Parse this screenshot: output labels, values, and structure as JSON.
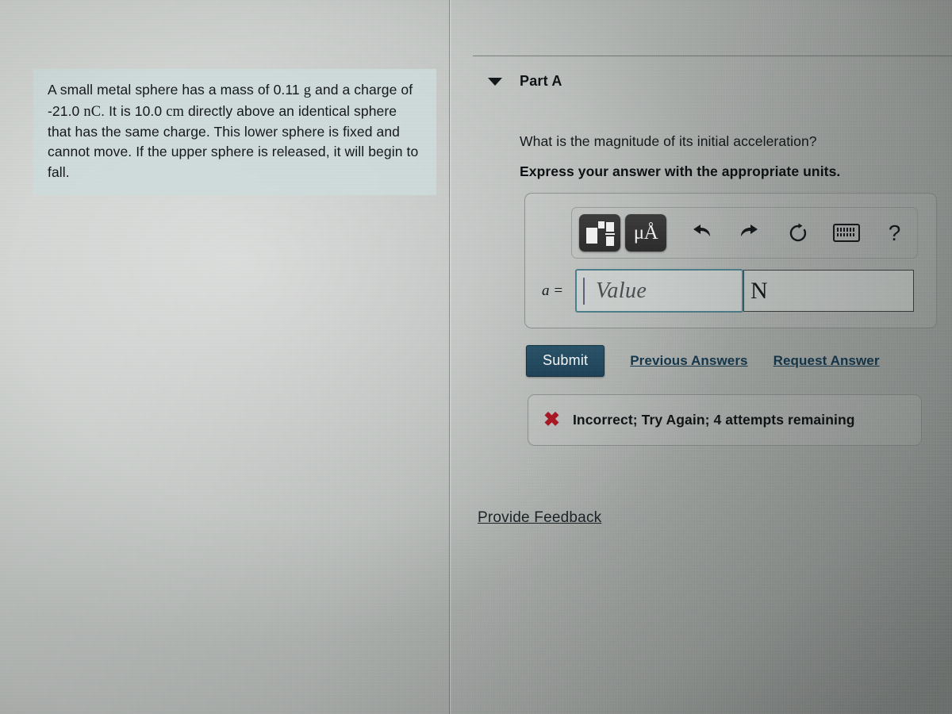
{
  "problem": {
    "text_part1": "A small metal sphere has a mass of 0.11 ",
    "mass_unit": "g",
    "text_part2": " and a charge of -21.0 ",
    "charge_unit": "nC",
    "text_part3": ". It is 10.0 ",
    "distance_unit": "cm",
    "text_part4": " directly above an identical sphere that has the same charge. This lower sphere is fixed and cannot move. If the upper sphere is released, it will begin to fall.",
    "full_text": "A small metal sphere has a mass of 0.11 g and a charge of -21.0 nC. It is 10.0 cm directly above an identical sphere that has the same charge. This lower sphere is fixed and cannot move. If the upper sphere is released, it will begin to fall."
  },
  "part": {
    "label": "Part A",
    "caret_icon": "caret-down-icon",
    "question": "What is the magnitude of its initial acceleration?",
    "instruction": "Express your answer with the appropriate units."
  },
  "toolbar": {
    "buttons": [
      {
        "name": "template-icon",
        "label": ""
      },
      {
        "name": "units-icon",
        "label": "μÅ"
      },
      {
        "name": "undo-icon",
        "label": ""
      },
      {
        "name": "redo-icon",
        "label": ""
      },
      {
        "name": "reset-icon",
        "label": ""
      },
      {
        "name": "keyboard-icon",
        "label": ""
      },
      {
        "name": "help-icon",
        "label": "?"
      }
    ],
    "mu_a": "μÅ",
    "help_symbol": "?"
  },
  "answer": {
    "variable_label": "a =",
    "value_placeholder": "Value",
    "units_value": "N"
  },
  "actions": {
    "submit_label": "Submit",
    "previous_answers_label": "Previous Answers",
    "request_answer_label": "Request Answer"
  },
  "feedback": {
    "x_symbol": "✖",
    "message": "Incorrect; Try Again; 4 attempts remaining",
    "provide_feedback_label": "Provide Feedback"
  },
  "colors": {
    "submit_bg": "#24495e",
    "link": "#14364a",
    "error_red": "#a61724",
    "focus_border": "#4e7d8a",
    "problem_bg": "#cdd bdb"
  }
}
